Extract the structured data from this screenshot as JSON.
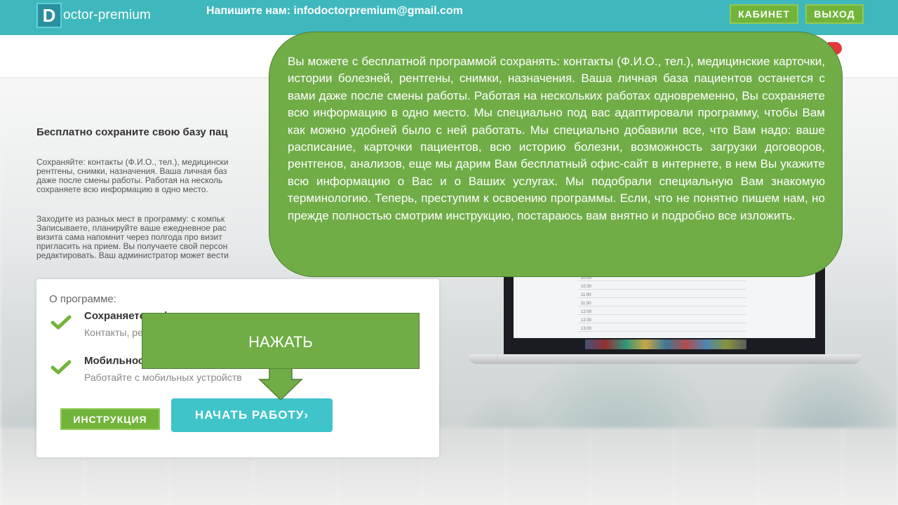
{
  "header": {
    "logo_letter": "D",
    "logo_text": "octor-premium",
    "contact": "Напишите нам: infodoctorpremium@gmail.com",
    "cabinet_label": "КАБИНЕТ",
    "exit_label": "ВЫХОД"
  },
  "main": {
    "heading": "Бесплатно сохраните свою базу пац",
    "paragraph1": [
      "Сохраняйте: контакты (Ф.И.О., тел.), медицински",
      "рентгены, снимки, назначения. Ваша личная баз",
      "даже после смены работы. Работая на несколь",
      "сохраняете всю информацию в одно место."
    ],
    "paragraph2": [
      "Заходите из разных мест в программу: с компьк",
      "Записываете, планируйте ваше ежедневное рас",
      "визита сама напомнит через полгода про визит",
      "пригласить на прием. Вы получаете свой персон",
      "редактировать. Ваш администратор может вести"
    ]
  },
  "about": {
    "title": "О программе:",
    "features": [
      {
        "title": "Сохраняете информацию:",
        "subtitle": "Контакты, рентгены, фото..."
      },
      {
        "title": "Мобильность программы:",
        "subtitle": "Работайте с мобильных устройств"
      }
    ],
    "instruction_label": "ИНСТРУКЦИЯ",
    "start_label": "НАЧАТЬ РАБОТУ›"
  },
  "laptop": {
    "times": [
      "10:00",
      "10:30",
      "11:00",
      "11:30",
      "12:00",
      "12:30",
      "13:00",
      "13:30"
    ]
  },
  "callout": {
    "text": "Вы можете с бесплатной программой сохранять: контакты (Ф.И.О., тел.), медицинские карточки, истории болезней, рентгены, снимки, назначения. Ваша личная база пациентов останется с вами даже после смены работы. Работая на нескольких работах одновременно, Вы сохраняете всю информацию в одно место. Мы специально под вас адаптировали программу, чтобы Вам как можно удобней было с ней работать. Мы специально добавили все, что Вам надо: ваше расписание, карточки пациентов, всю историю болезни, возможность загрузки договоров, рентгенов, анализов, еще мы дарим Вам бесплатный офис-сайт в интернете, в нем Вы укажите всю информацию о Вас и о Ваших услугах. Мы подобрали специальную Вам знакомую терминологию. Теперь, преступим к освоению программы. Если, что не понятно пишем нам, но прежде полностью смотрим инструкцию, постараюсь вам внятно и подробно все изложить."
  },
  "press": {
    "label": "НАЖАТЬ"
  },
  "colors": {
    "topbar": "#3fb8bd",
    "green_button": "#72b43a",
    "start_button": "#3fc4ca",
    "callout": "#70ad47"
  },
  "icons": [
    "checkmark-icon",
    "down-arrow-icon"
  ]
}
